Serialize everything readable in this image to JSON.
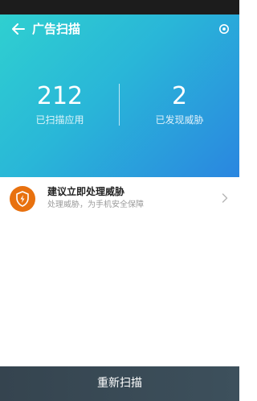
{
  "header": {
    "title": "广告扫描",
    "back_icon": "arrow-left-icon",
    "settings_icon": "settings-icon"
  },
  "stats": {
    "scanned_apps": {
      "value": "212",
      "label": "已扫描应用"
    },
    "threats_found": {
      "value": "2",
      "label": "已发现威胁"
    }
  },
  "threat_item": {
    "icon": "shield-lightning-icon",
    "title": "建议立即处理威胁",
    "subtitle": "处理威胁，为手机安全保障",
    "chevron_icon": "chevron-right-icon"
  },
  "footer": {
    "rescan_label": "重新扫描"
  },
  "colors": {
    "header_gradient_start": "#2fd0d0",
    "header_gradient_end": "#2a86e0",
    "threat_icon_bg": "#e8710f",
    "footer_bg": "#3a4a55"
  }
}
